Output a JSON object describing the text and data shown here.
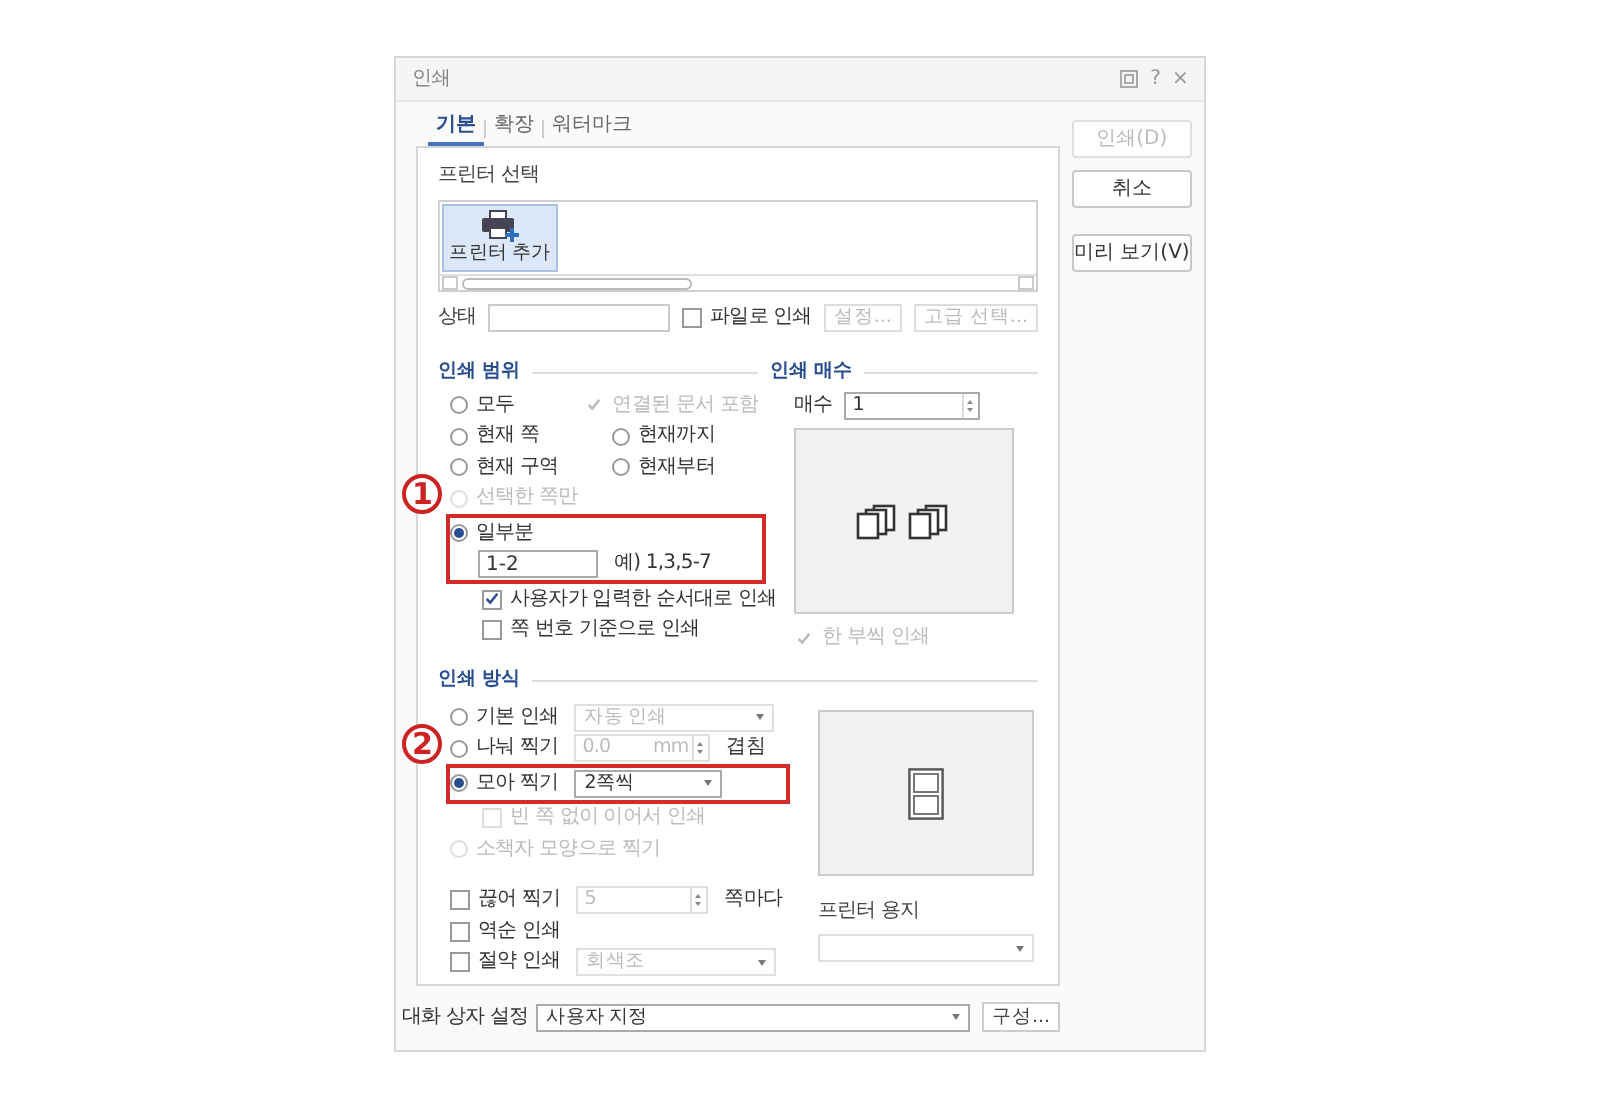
{
  "window": {
    "title": "인쇄",
    "help": "?",
    "close": "×"
  },
  "tabs": [
    {
      "label": "기본",
      "selected": true
    },
    {
      "label": "확장",
      "selected": false
    },
    {
      "label": "워터마크",
      "selected": false
    }
  ],
  "side_buttons": [
    {
      "label": "인쇄(D)",
      "disabled": true
    },
    {
      "label": "취소",
      "disabled": false
    },
    {
      "label": "미리 보기(V)",
      "disabled": false
    }
  ],
  "printer": {
    "title": "프린터 선택",
    "printers": [
      {
        "label": "프린터 추가",
        "selected": true
      }
    ],
    "status_label": "상태",
    "to_file": {
      "label": "파일로 인쇄",
      "checked": false
    },
    "buttons": [
      {
        "label": "설정...",
        "disabled": true
      },
      {
        "label": "고급 선택...",
        "disabled": true
      }
    ]
  },
  "print_range": {
    "title": "인쇄 범위",
    "rows": [
      {
        "items": [
          {
            "kind": "radio",
            "label": "모두",
            "selected": false,
            "disabled": false
          },
          {
            "kind": "checkbox",
            "label": "연결된 문서 포함",
            "checked": true,
            "disabled": true
          }
        ]
      },
      {
        "items": [
          {
            "kind": "radio",
            "label": "현재 쪽",
            "selected": false,
            "disabled": false
          },
          {
            "kind": "radio",
            "label": "현재까지",
            "selected": false,
            "disabled": false
          }
        ]
      },
      {
        "items": [
          {
            "kind": "radio",
            "label": "현재 구역",
            "selected": false,
            "disabled": false
          },
          {
            "kind": "radio",
            "label": "현재부터",
            "selected": false,
            "disabled": false
          }
        ]
      },
      {
        "items": [
          {
            "kind": "radio",
            "label": "선택한 쪽만",
            "selected": false,
            "disabled": true
          }
        ]
      },
      {
        "callout": "1",
        "rows": [
          {
            "items": [
              {
                "kind": "radio",
                "label": "일부분",
                "selected": true,
                "disabled": false
              }
            ],
            "children": [
              {
                "items": [
                  {
                    "kind": "field",
                    "value": "1-2"
                  },
                  {
                    "kind": "text",
                    "label": "예) 1,3,5-7"
                  }
                ]
              }
            ]
          }
        ],
        "children": [
          {
            "items": [
              {
                "kind": "checkbox",
                "label": "사용자가 입력한 순서대로 인쇄",
                "checked": true,
                "disabled": false
              }
            ]
          },
          {
            "items": [
              {
                "kind": "checkbox",
                "label": "쪽 번호 기준으로 인쇄",
                "checked": false,
                "disabled": false
              }
            ]
          }
        ]
      }
    ]
  },
  "copies": {
    "title": "인쇄 매수",
    "label": "매수",
    "value": "1",
    "collate": {
      "label": "한 부씩 인쇄",
      "checked": true,
      "disabled": true
    }
  },
  "print_method": {
    "title": "인쇄 방식",
    "rows": [
      {
        "items": [
          {
            "kind": "radio",
            "label": "기본 인쇄",
            "selected": false,
            "disabled": false
          },
          {
            "kind": "dropdown",
            "value": "자동 인쇄",
            "disabled": true
          }
        ]
      },
      {
        "items": [
          {
            "kind": "radio",
            "label": "나눠 찍기",
            "selected": false,
            "disabled": false
          },
          {
            "kind": "spin",
            "value": "0.0",
            "unit": "mm",
            "disabled": true
          },
          {
            "kind": "text",
            "label": "겹침"
          }
        ]
      },
      {
        "callout": "2",
        "rows": [
          {
            "items": [
              {
                "kind": "radio",
                "label": "모아 찍기",
                "selected": true,
                "disabled": false
              },
              {
                "kind": "dropdown",
                "value": "2쪽씩",
                "disabled": false
              }
            ]
          }
        ],
        "children": [
          {
            "items": [
              {
                "kind": "checkbox",
                "label": "빈 쪽 없이 이어서 인쇄",
                "checked": false,
                "disabled": true
              }
            ]
          }
        ]
      },
      {
        "items": [
          {
            "kind": "radio",
            "label": "소책자 모양으로 찍기",
            "selected": false,
            "disabled": true
          }
        ]
      }
    ],
    "extra_rows": [
      {
        "items": [
          {
            "kind": "checkbox",
            "label": "끊어 찍기",
            "checked": false,
            "disabled": false
          },
          {
            "kind": "spin",
            "value": "5",
            "disabled": true
          },
          {
            "kind": "text",
            "label": "쪽마다"
          }
        ]
      },
      {
        "items": [
          {
            "kind": "checkbox",
            "label": "역순 인쇄",
            "checked": false,
            "disabled": false
          }
        ]
      },
      {
        "items": [
          {
            "kind": "checkbox",
            "label": "절약 인쇄",
            "checked": false,
            "disabled": false
          },
          {
            "kind": "dropdown",
            "value": "회색조",
            "disabled": true
          }
        ]
      }
    ]
  },
  "paper": {
    "label": "프린터 용지",
    "disabled": true
  },
  "dialog_settings": {
    "label": "대화 상자 설정",
    "value": "사용자 지정",
    "button": "구성..."
  }
}
